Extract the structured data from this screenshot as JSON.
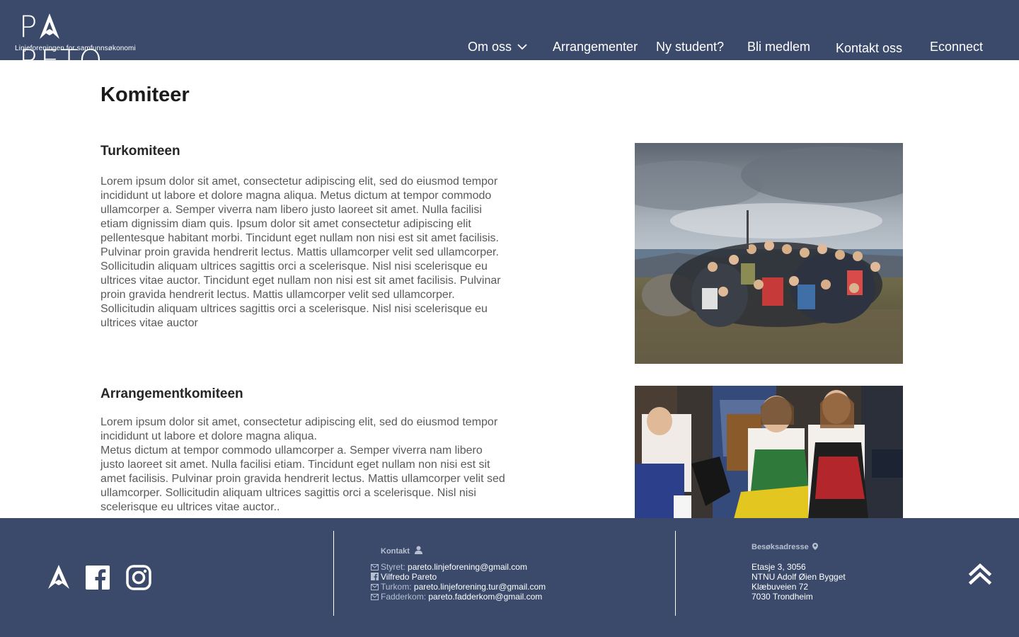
{
  "brand": {
    "name": "PARETO",
    "name_before_mark": "P",
    "name_after_mark": "RETO",
    "tagline": "Linjeforeningen for samfunnsøkonomi"
  },
  "nav": {
    "items": [
      {
        "label": "Om oss",
        "has_dropdown": true
      },
      {
        "label": "Arrangementer"
      },
      {
        "label": "Ny student?"
      },
      {
        "label": "Bli medlem"
      },
      {
        "label": "Kontakt oss"
      },
      {
        "label": "Econnect"
      }
    ]
  },
  "main": {
    "title": "Komiteer",
    "sections": [
      {
        "title": "Turkomiteen",
        "paragraphs": [
          "Lorem ipsum dolor sit amet, consectetur adipiscing elit, sed do eiusmod tempor incididunt ut labore et dolore magna aliqua. Metus dictum at tempor commodo ullamcorper a. Semper viverra nam libero justo laoreet sit amet. Nulla facilisi etiam dignissim diam quis. Ipsum dolor sit amet consectetur adipiscing elit pellentesque habitant morbi. Tincidunt eget nullam non nisi est sit amet facilisis. Pulvinar proin gravida hendrerit lectus. Mattis ullamcorper velit sed ullamcorper. Sollicitudin aliquam ultrices sagittis orci a scelerisque. Nisl nisi scelerisque eu ultrices vitae auctor. Tincidunt eget nullam non nisi est sit amet facilisis. Pulvinar proin gravida hendrerit lectus. Mattis ullamcorper velit sed ullamcorper. Sollicitudin aliquam ultrices sagittis orci a scelerisque. Nisl nisi scelerisque eu ultrices vitae auctor"
        ],
        "image": "group-photo-mountain"
      },
      {
        "title": "Arrangementkomiteen",
        "paragraphs": [
          "Lorem ipsum dolor sit amet, consectetur adipiscing elit, sed do eiusmod tempor incididunt ut labore et dolore magna aliqua.",
          "Metus dictum at tempor commodo ullamcorper a. Semper viverra nam libero justo laoreet sit amet. Nulla facilisi etiam. Tincidunt eget nullam non nisi est sit amet facilisis. Pulvinar proin gravida hendrerit lectus. Mattis ullamcorper velit sed ullamcorper. Sollicitudin aliquam ultrices sagittis orci a scelerisque. Nisl nisi scelerisque eu ultrices vitae auctor.."
        ],
        "image": "group-photo-party"
      }
    ]
  },
  "footer": {
    "social_icons": [
      "pareto-a-icon",
      "facebook-icon",
      "instagram-icon"
    ],
    "contact": {
      "heading": "Kontakt",
      "lines": [
        {
          "icon": "mail-icon",
          "label": "Styret:",
          "value": "pareto.linjeforening@gmail.com"
        },
        {
          "icon": "facebook-icon",
          "label": "",
          "value": "Vilfredo Pareto"
        },
        {
          "icon": "mail-icon",
          "label": "Turkom:",
          "value": "pareto.linjeforening.tur@gmail.com"
        },
        {
          "icon": "mail-icon",
          "label": "Fadderkom:",
          "value": "pareto.fadderkom@gmail.com"
        }
      ]
    },
    "address": {
      "heading": "Besøksadresse",
      "lines": [
        "Etasje 3, 3056",
        "NTNU Adolf Øien Bygget",
        "Klæbuveien 72",
        "7030 Trondheim"
      ]
    }
  },
  "colors": {
    "brand_navy": "#3b4a6b",
    "muted_label": "#b7c0d1",
    "body_text": "#5a5a5a"
  }
}
